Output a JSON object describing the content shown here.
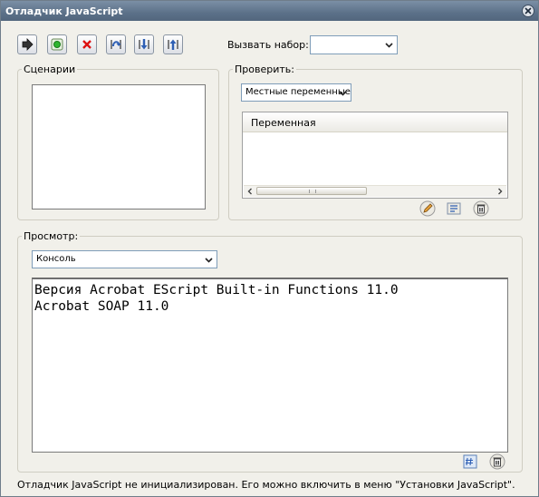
{
  "window": {
    "title": "Отладчик JavaScript"
  },
  "toolbar": {
    "buttons": [
      {
        "name": "resume-button",
        "icon": "play-arrow-icon"
      },
      {
        "name": "break-button",
        "icon": "green-dot-icon"
      },
      {
        "name": "quit-button",
        "icon": "red-x-icon"
      },
      {
        "name": "step-over-button",
        "icon": "step-over-icon"
      },
      {
        "name": "step-into-button",
        "icon": "step-into-icon"
      },
      {
        "name": "step-out-button",
        "icon": "step-out-icon"
      }
    ],
    "call_stack_label": "Вызвать набор:",
    "call_stack_value": ""
  },
  "scripts": {
    "legend": "Сценарии"
  },
  "inspect": {
    "legend": "Проверить:",
    "dropdown_value": "Местные переменные",
    "column_header": "Переменная",
    "icons": [
      "edit-pencil-icon",
      "watch-icon",
      "delete-trash-icon"
    ]
  },
  "view": {
    "legend": "Просмотр:",
    "dropdown_value": "Консоль",
    "console_lines": [
      "Версия Acrobat EScript Built-in Functions 11.0",
      "Acrobat SOAP 11.0"
    ],
    "icons": [
      "evaluate-icon",
      "clear-trash-icon"
    ]
  },
  "status": {
    "text": "Отладчик JavaScript не инициализирован. Его можно включить в меню \"Установки JavaScript\"."
  },
  "colors": {
    "title_bar": "#5c7189",
    "dialog_bg": "#f1f0ea",
    "frame_border": "#cfcdc2",
    "arrow_blue": "#2e5fb4"
  }
}
